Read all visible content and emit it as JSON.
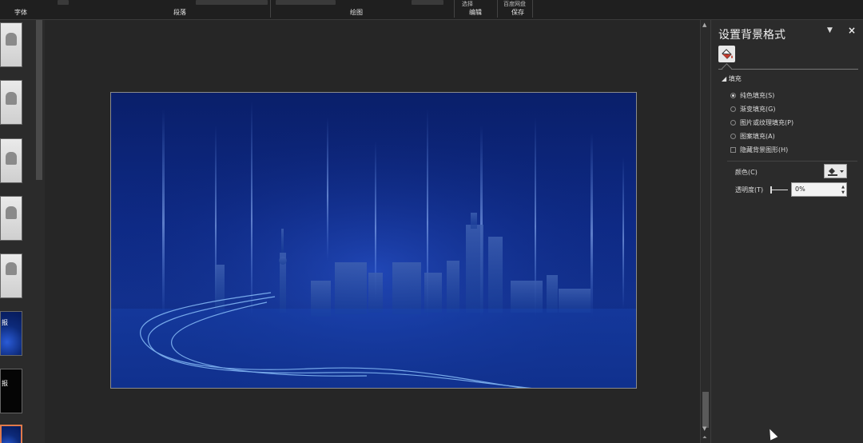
{
  "ribbon": {
    "groups": [
      {
        "label": "字体"
      },
      {
        "label": "段落"
      },
      {
        "label": "绘图"
      },
      {
        "label": "编辑"
      },
      {
        "label": "保存"
      }
    ],
    "top_labels": {
      "select": "选择",
      "baidu": "百度网盘"
    }
  },
  "thumbnails": {
    "items": [
      {
        "kind": "light"
      },
      {
        "kind": "light"
      },
      {
        "kind": "light"
      },
      {
        "kind": "light"
      },
      {
        "kind": "light"
      },
      {
        "kind": "blue",
        "text": "报"
      },
      {
        "kind": "dark",
        "text": "报"
      },
      {
        "kind": "blue",
        "selected": true
      }
    ]
  },
  "pane": {
    "title": "设置背景格式",
    "close": "×",
    "section_label": "填充",
    "options": [
      {
        "label": "纯色填充(S)",
        "type": "radio",
        "checked": true
      },
      {
        "label": "渐变填充(G)",
        "type": "radio",
        "checked": false
      },
      {
        "label": "图片或纹理填充(P)",
        "type": "radio",
        "checked": false
      },
      {
        "label": "图案填充(A)",
        "type": "radio",
        "checked": false
      },
      {
        "label": "隐藏背景图形(H)",
        "type": "checkbox",
        "checked": false
      }
    ],
    "color_label": "颜色(C)",
    "transparency_label": "透明度(T)",
    "transparency_value": "0%",
    "transparency": 0
  },
  "colors": {
    "slide_bg": "#0e2a86",
    "app_bg": "#2b2b2b",
    "selection": "#e07a4a"
  }
}
